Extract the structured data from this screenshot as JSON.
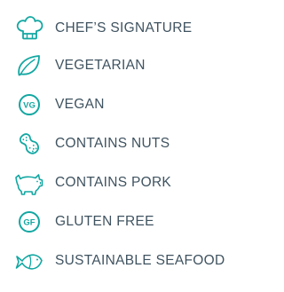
{
  "accent_color": "#12a7a2",
  "text_color": "#3f5360",
  "legend": {
    "items": [
      {
        "icon": "chef-hat-icon",
        "label": "CHEF’S SIGNATURE"
      },
      {
        "icon": "leaf-icon",
        "label": "VEGETARIAN"
      },
      {
        "icon": "vegan-badge-icon",
        "label": "VEGAN",
        "badge": "VG"
      },
      {
        "icon": "peanut-icon",
        "label": "CONTAINS NUTS"
      },
      {
        "icon": "pig-icon",
        "label": "CONTAINS PORK"
      },
      {
        "icon": "gluten-free-badge-icon",
        "label": "GLUTEN FREE",
        "badge": "GF"
      },
      {
        "icon": "fish-icon",
        "label": "SUSTAINABLE SEAFOOD"
      }
    ]
  }
}
